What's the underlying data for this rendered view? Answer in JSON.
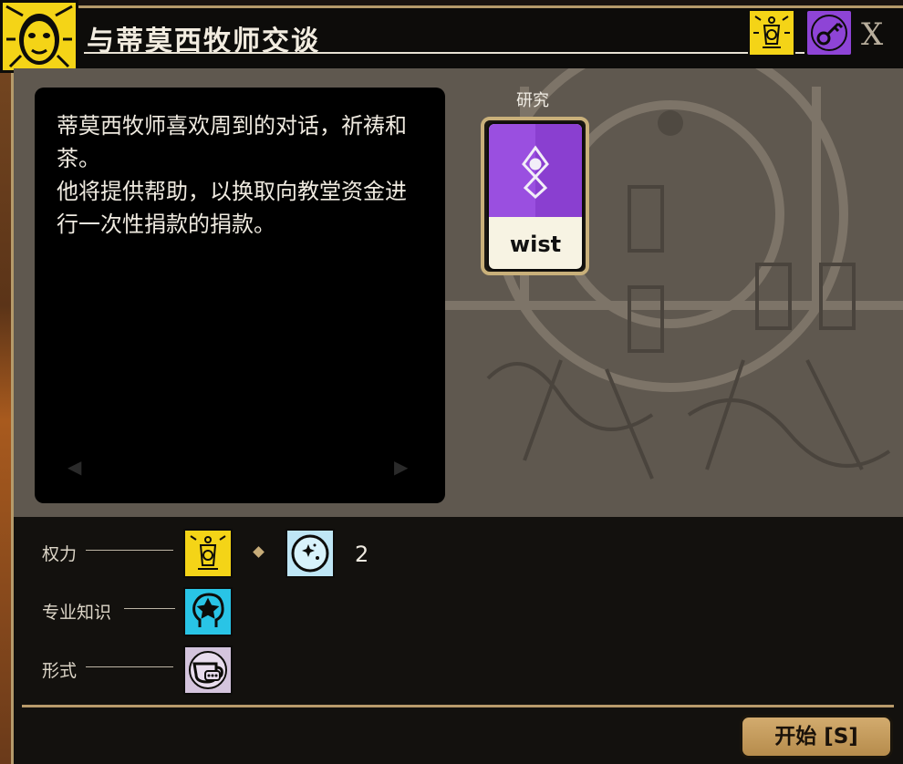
{
  "window": {
    "title": "与蒂莫西牧师交谈",
    "close_label": "X"
  },
  "header_icons": [
    {
      "icon": "lantern-icon",
      "color": "#f4d417"
    },
    {
      "icon": "key-icon",
      "color": "#8e44d6"
    }
  ],
  "description": {
    "text": "蒂莫西牧师喜欢周到的对话，祈祷和茶。\n他将提供帮助，以换取向教堂资金进行一次性捐款的捐款。",
    "prev_arrow": "◀",
    "next_arrow": "▶"
  },
  "slot": {
    "label": "研究",
    "card": {
      "name": "wist",
      "color": "#9a4fe0"
    }
  },
  "requirements": [
    {
      "label": "权力",
      "icons": [
        "lantern-icon",
        "glow-orb-icon"
      ],
      "count": "2"
    },
    {
      "label": "专业知识",
      "icons": [
        "mind-star-icon"
      ]
    },
    {
      "label": "形式",
      "icons": [
        "teacup-icon"
      ]
    }
  ],
  "actions": {
    "start_label": "开始 [S]"
  }
}
